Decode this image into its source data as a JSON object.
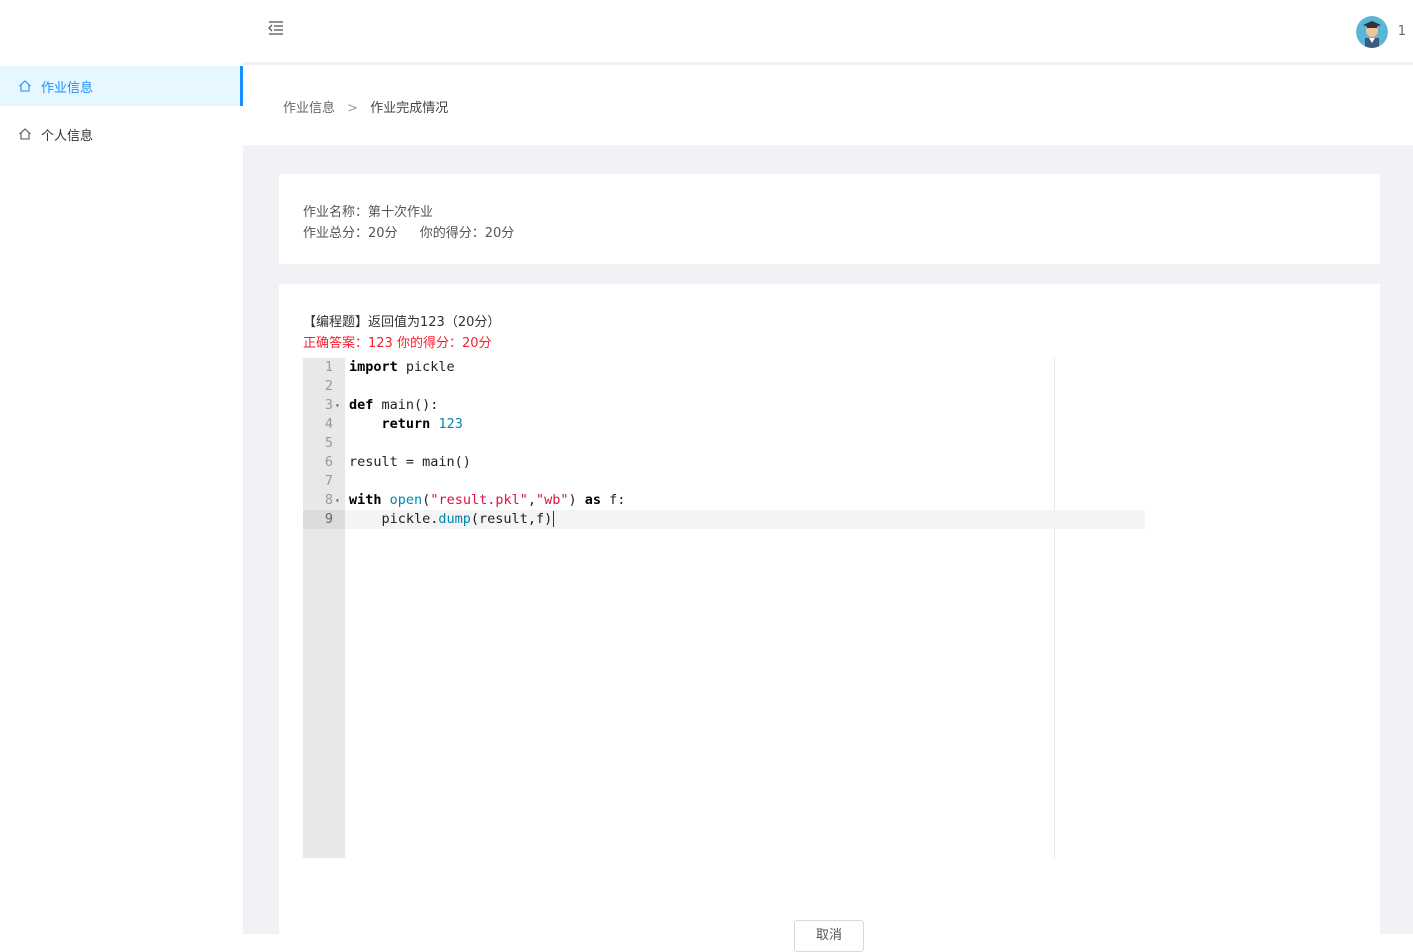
{
  "sidebar": {
    "items": [
      {
        "label": "作业信息",
        "icon": "home-icon",
        "active": true
      },
      {
        "label": "个人信息",
        "icon": "home-icon",
        "active": false
      }
    ]
  },
  "header": {
    "collapse_icon": "menu-fold-icon",
    "user_name": "1"
  },
  "breadcrumb": {
    "items": [
      "作业信息",
      "作业完成情况"
    ],
    "separator": ">"
  },
  "homework": {
    "name_line": "作业名称：第十次作业",
    "total_score": "作业总分：20分",
    "your_score": "你的得分：20分"
  },
  "question": {
    "title": "【编程题】返回值为123（20分）",
    "answer_line": "正确答案：123  你的得分：20分",
    "code_lines": [
      "import pickle",
      "",
      "def main():",
      "    return 123",
      "",
      "result = main()",
      "",
      "with open(\"result.pkl\",\"wb\") as f:",
      "    pickle.dump(result,f)"
    ],
    "active_line": 9
  },
  "buttons": {
    "cancel": "取消"
  },
  "colors": {
    "accent": "#1890ff",
    "error": "#f5222d",
    "content_bg": "#f0f2f5"
  }
}
